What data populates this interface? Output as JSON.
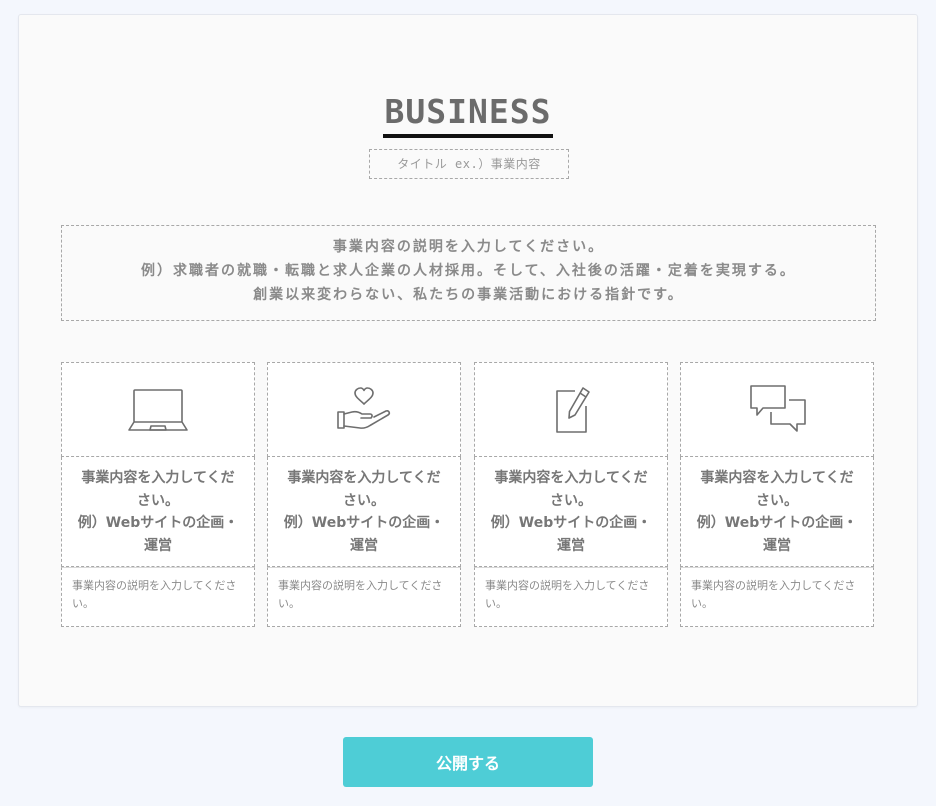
{
  "section": {
    "title": "BUSINESS",
    "subtitle_placeholder": "タイトル ex.）事業内容",
    "description_lines": [
      "事業内容の説明を入力してください。",
      "例）求職者の就職・転職と求人企業の人材採用。そして、入社後の活躍・定着を実現する。",
      "創業以来変わらない、私たちの事業活動における指針です。"
    ]
  },
  "cards": [
    {
      "icon": "laptop-icon",
      "heading_lines": [
        "事業内容を入力してくだ",
        "さい。",
        "例）Webサイトの企画・",
        "運営"
      ],
      "body": "事業内容の説明を入力してください。"
    },
    {
      "icon": "hand-heart-icon",
      "heading_lines": [
        "事業内容を入力してくだ",
        "さい。",
        "例）Webサイトの企画・",
        "運営"
      ],
      "body": "事業内容の説明を入力してください。"
    },
    {
      "icon": "edit-note-icon",
      "heading_lines": [
        "事業内容を入力してくだ",
        "さい。",
        "例）Webサイトの企画・",
        "運営"
      ],
      "body": "事業内容の説明を入力してください。"
    },
    {
      "icon": "chat-bubbles-icon",
      "heading_lines": [
        "事業内容を入力してくだ",
        "さい。",
        "例）Webサイトの企画・",
        "運営"
      ],
      "body": "事業内容の説明を入力してください。"
    }
  ],
  "footer": {
    "publish_label": "公開する"
  },
  "colors": {
    "accent": "#4ecdd6",
    "title_underline": "#111111",
    "page_background": "#f4f7fd"
  }
}
